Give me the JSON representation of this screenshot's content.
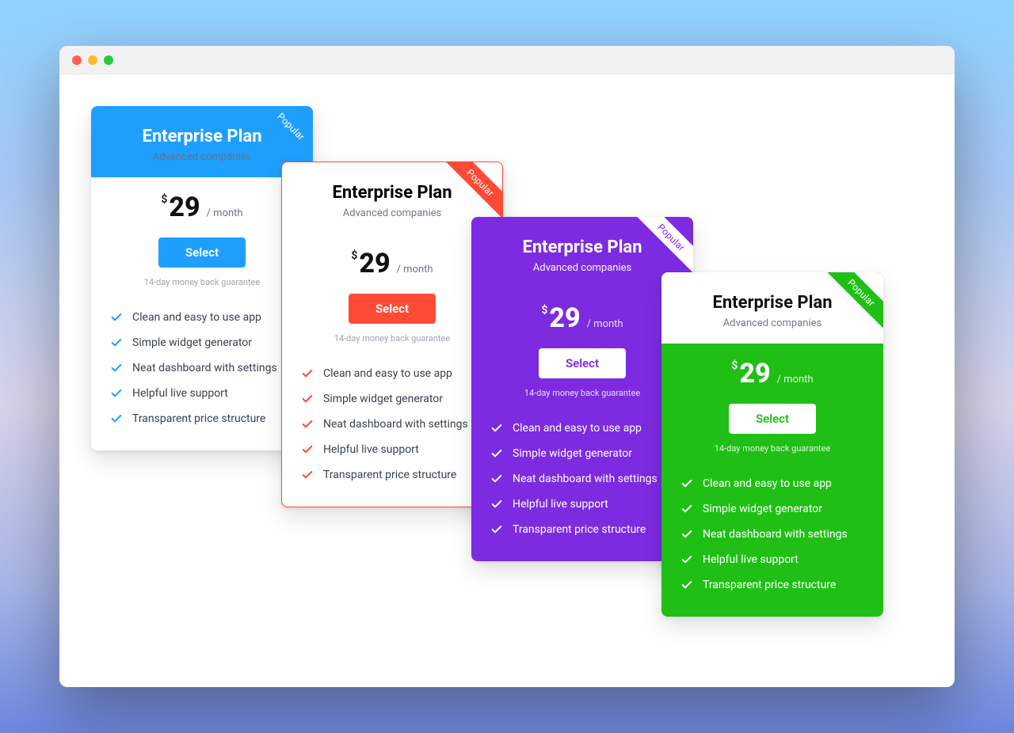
{
  "ribbon_label": "Popular",
  "plan": {
    "title": "Enterprise Plan",
    "subtitle": "Advanced companies",
    "currency": "$",
    "price": "29",
    "period": "/ month",
    "cta": "Select",
    "guarantee": "14-day money back guarantee"
  },
  "features": [
    "Clean and easy to use app",
    "Simple widget generator",
    "Neat dashboard with settings",
    "Helpful live support",
    "Transparent price structure"
  ],
  "cards": [
    {
      "id": "c1",
      "variant": "header-solid",
      "accent": "#1e9ffd"
    },
    {
      "id": "c2",
      "variant": "outlined",
      "accent": "#ff4a36"
    },
    {
      "id": "c3",
      "variant": "solid",
      "accent": "#7c2be0"
    },
    {
      "id": "c4",
      "variant": "solid",
      "accent": "#1fbf16"
    }
  ]
}
